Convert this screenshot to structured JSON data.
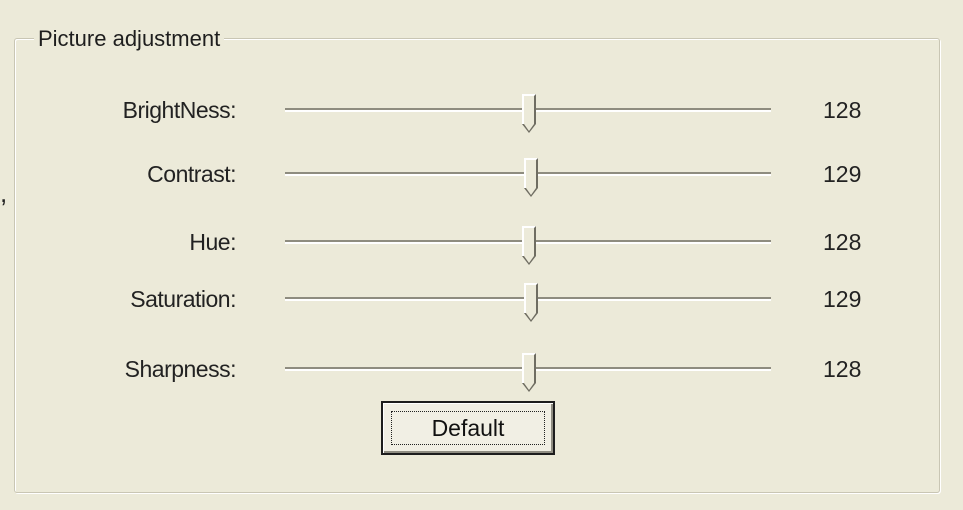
{
  "stray_mark": ",",
  "group": {
    "title": "Picture adjustment"
  },
  "sliders": [
    {
      "label": "BrightNess:",
      "value": "128",
      "level": 128,
      "min": 0,
      "max": 255
    },
    {
      "label": "Contrast:",
      "value": "129",
      "level": 129,
      "min": 0,
      "max": 255
    },
    {
      "label": "Hue:",
      "value": "128",
      "level": 128,
      "min": 0,
      "max": 255
    },
    {
      "label": "Saturation:",
      "value": "129",
      "level": 129,
      "min": 0,
      "max": 255
    },
    {
      "label": "Sharpness:",
      "value": "128",
      "level": 128,
      "min": 0,
      "max": 255
    }
  ],
  "buttons": {
    "default_label": "Default"
  },
  "colors": {
    "window_background": "#ecead9",
    "track": "#8e8c7f",
    "text": "#222222"
  }
}
